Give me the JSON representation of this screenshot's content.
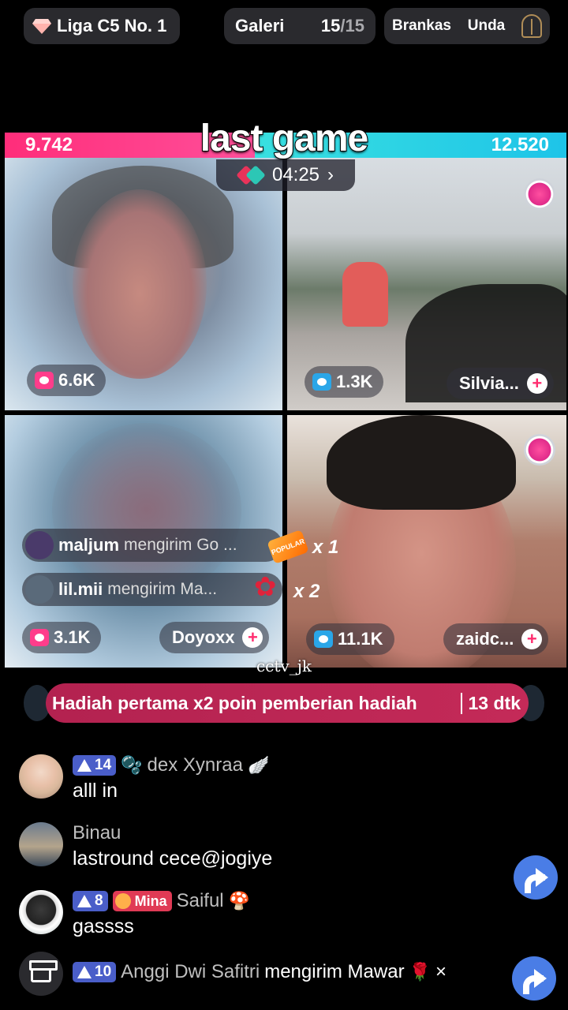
{
  "top_bar": {
    "league_label": "Liga C5 No. 1",
    "gallery_label": "Galeri",
    "gallery_count_current": "15",
    "gallery_count_total": "/15",
    "vault_label": "Brankas",
    "unda_label": "Unda"
  },
  "battle": {
    "overlay_title": "last game",
    "score_left": "9.742",
    "score_right": "12.520",
    "timer": "04:25",
    "timer_chevron": "›",
    "tiles": [
      {
        "likes": "6.6K"
      },
      {
        "likes": "1.3K",
        "name": "Silvia..."
      },
      {
        "likes": "3.1K",
        "name": "Doyoxx"
      },
      {
        "likes": "11.1K",
        "name": "zaidc..."
      }
    ],
    "gifts": [
      {
        "user": "maljum",
        "text": "mengirim Go ...",
        "tag": "POPULAR",
        "multiplier": "x 1"
      },
      {
        "user": "lil.mii",
        "text": "mengirim Ma...",
        "multiplier": "x 2"
      }
    ]
  },
  "watermark": "cctv_jk",
  "banner": {
    "text": "Hadiah pertama x2 poin pemberian hadiah",
    "time": "13 dtk"
  },
  "chat": [
    {
      "level": "14",
      "deco": "🫧",
      "name": "dex Xynraa",
      "suffix": "🪽",
      "message": "alll in"
    },
    {
      "name": "Binau",
      "message": "lastround cece@jogiye"
    },
    {
      "level": "8",
      "fan_badge": "Mina",
      "name": "Saiful",
      "suffix": "🍄",
      "message": "gassss"
    },
    {
      "level": "10",
      "name": "Anggi Dwi Safitri",
      "action": "mengirim Mawar",
      "gift": "🌹",
      "multiplier": "×"
    }
  ],
  "colors": {
    "score_left": "#ff2d7a",
    "score_right": "#1ec4e8",
    "banner": "#b32250",
    "level_badge": "#4a5ec9",
    "share": "#4a7de6"
  }
}
